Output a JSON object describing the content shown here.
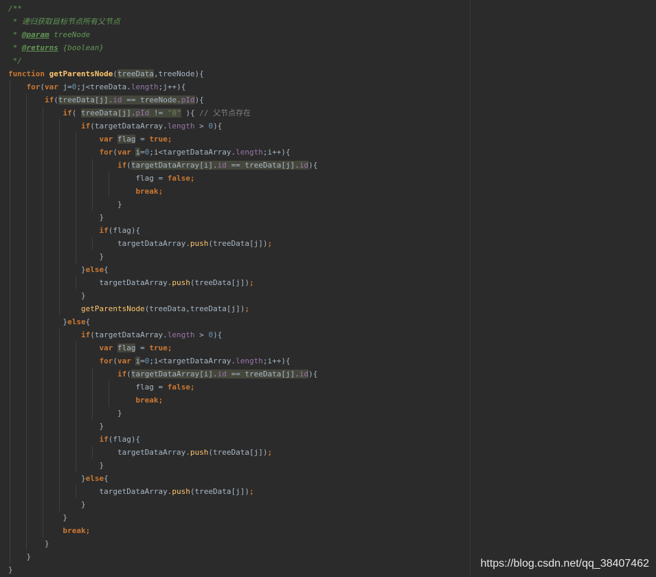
{
  "editor": {
    "lines": [
      {
        "indent": 0,
        "tokens": [
          {
            "t": "/**",
            "c": "cmt"
          }
        ]
      },
      {
        "indent": 0,
        "tokens": [
          {
            "t": " * 递归获取目标节点所有父节点",
            "c": "cmt"
          }
        ]
      },
      {
        "indent": 0,
        "tokens": [
          {
            "t": " * ",
            "c": "cmt"
          },
          {
            "t": "@param",
            "c": "tag"
          },
          {
            "t": " treeNode",
            "c": "type"
          }
        ]
      },
      {
        "indent": 0,
        "tokens": [
          {
            "t": " * ",
            "c": "cmt"
          },
          {
            "t": "@returns",
            "c": "tag"
          },
          {
            "t": " {boolean}",
            "c": "type"
          }
        ]
      },
      {
        "indent": 0,
        "tokens": [
          {
            "t": " */",
            "c": "cmt"
          }
        ]
      },
      {
        "indent": 0,
        "tokens": [
          {
            "t": "function ",
            "c": "kw"
          },
          {
            "t": "getParentsNode",
            "c": "fndef"
          },
          {
            "t": "(",
            "c": "p"
          },
          {
            "t": "treeData",
            "c": "p",
            "hl": true
          },
          {
            "t": ",treeNode){",
            "c": "p"
          }
        ]
      },
      {
        "indent": 1,
        "tokens": [
          {
            "t": "for",
            "c": "kw"
          },
          {
            "t": "(",
            "c": "p"
          },
          {
            "t": "var ",
            "c": "kw"
          },
          {
            "t": "j=",
            "c": "p"
          },
          {
            "t": "0",
            "c": "num"
          },
          {
            "t": ";j<treeData.",
            "c": "p"
          },
          {
            "t": "length",
            "c": "prop"
          },
          {
            "t": ";j++){",
            "c": "p"
          }
        ]
      },
      {
        "indent": 2,
        "tokens": [
          {
            "t": "if",
            "c": "kw"
          },
          {
            "t": "(",
            "c": "p"
          },
          {
            "t": "treeData[j].",
            "c": "p",
            "hl": true
          },
          {
            "t": "id",
            "c": "prop",
            "hl": true
          },
          {
            "t": " == treeNode.",
            "c": "p",
            "hl": true
          },
          {
            "t": "pId",
            "c": "prop",
            "hl": true
          },
          {
            "t": "){",
            "c": "p"
          }
        ]
      },
      {
        "indent": 3,
        "tokens": [
          {
            "t": "if",
            "c": "kw"
          },
          {
            "t": "( ",
            "c": "p"
          },
          {
            "t": "treeData[j].",
            "c": "p",
            "hl": true
          },
          {
            "t": "pId",
            "c": "prop",
            "hl": true
          },
          {
            "t": " != ",
            "c": "p",
            "hl": true
          },
          {
            "t": "\"0\"",
            "c": "str",
            "hl": true
          },
          {
            "t": " ){ ",
            "c": "p"
          },
          {
            "t": "// 父节点存在",
            "c": "cmt-line"
          }
        ]
      },
      {
        "indent": 4,
        "tokens": [
          {
            "t": "if",
            "c": "kw"
          },
          {
            "t": "(targetDataArray.",
            "c": "p"
          },
          {
            "t": "length",
            "c": "prop"
          },
          {
            "t": " > ",
            "c": "p"
          },
          {
            "t": "0",
            "c": "num"
          },
          {
            "t": "){",
            "c": "p"
          }
        ]
      },
      {
        "indent": 5,
        "tokens": [
          {
            "t": "var ",
            "c": "kw"
          },
          {
            "t": "flag",
            "c": "p",
            "hl": true
          },
          {
            "t": " = ",
            "c": "p"
          },
          {
            "t": "true",
            "c": "kw"
          },
          {
            "t": ";",
            "c": "kw"
          }
        ]
      },
      {
        "indent": 5,
        "tokens": [
          {
            "t": "for",
            "c": "kw"
          },
          {
            "t": "(",
            "c": "p"
          },
          {
            "t": "var ",
            "c": "kw"
          },
          {
            "t": "i",
            "c": "p",
            "hl": true
          },
          {
            "t": "=",
            "c": "p"
          },
          {
            "t": "0",
            "c": "num"
          },
          {
            "t": ";i<targetDataArray.",
            "c": "p"
          },
          {
            "t": "length",
            "c": "prop"
          },
          {
            "t": ";i++){",
            "c": "p"
          }
        ]
      },
      {
        "indent": 6,
        "tokens": [
          {
            "t": "if",
            "c": "kw"
          },
          {
            "t": "(",
            "c": "p"
          },
          {
            "t": "targetDataArray[i].",
            "c": "p",
            "hl": true
          },
          {
            "t": "id",
            "c": "prop",
            "hl": true
          },
          {
            "t": " == treeData[j].",
            "c": "p",
            "hl": true
          },
          {
            "t": "id",
            "c": "prop",
            "hl": true
          },
          {
            "t": "){",
            "c": "p"
          }
        ]
      },
      {
        "indent": 7,
        "tokens": [
          {
            "t": "flag = ",
            "c": "p"
          },
          {
            "t": "false",
            "c": "kw"
          },
          {
            "t": ";",
            "c": "kw"
          }
        ]
      },
      {
        "indent": 7,
        "tokens": [
          {
            "t": "break",
            "c": "kw"
          },
          {
            "t": ";",
            "c": "kw"
          }
        ]
      },
      {
        "indent": 6,
        "tokens": [
          {
            "t": "}",
            "c": "p"
          }
        ]
      },
      {
        "indent": 5,
        "tokens": [
          {
            "t": "}",
            "c": "p"
          }
        ]
      },
      {
        "indent": 5,
        "tokens": [
          {
            "t": "if",
            "c": "kw"
          },
          {
            "t": "(flag){",
            "c": "p"
          }
        ]
      },
      {
        "indent": 6,
        "tokens": [
          {
            "t": "targetDataArray.",
            "c": "p"
          },
          {
            "t": "push",
            "c": "fn"
          },
          {
            "t": "(treeData[j])",
            "c": "p"
          },
          {
            "t": ";",
            "c": "kw"
          }
        ]
      },
      {
        "indent": 5,
        "tokens": [
          {
            "t": "}",
            "c": "p"
          }
        ]
      },
      {
        "indent": 4,
        "tokens": [
          {
            "t": "}",
            "c": "p"
          },
          {
            "t": "else",
            "c": "kw"
          },
          {
            "t": "{",
            "c": "p"
          }
        ]
      },
      {
        "indent": 5,
        "tokens": [
          {
            "t": "targetDataArray.",
            "c": "p"
          },
          {
            "t": "push",
            "c": "fn"
          },
          {
            "t": "(treeData[j])",
            "c": "p"
          },
          {
            "t": ";",
            "c": "kw"
          }
        ]
      },
      {
        "indent": 4,
        "tokens": [
          {
            "t": "}",
            "c": "p"
          }
        ]
      },
      {
        "indent": 4,
        "tokens": [
          {
            "t": "getParentsNode",
            "c": "fn"
          },
          {
            "t": "(treeData,treeData[j])",
            "c": "p"
          },
          {
            "t": ";",
            "c": "kw"
          }
        ]
      },
      {
        "indent": 3,
        "tokens": [
          {
            "t": "}",
            "c": "p"
          },
          {
            "t": "else",
            "c": "kw"
          },
          {
            "t": "{",
            "c": "p"
          }
        ]
      },
      {
        "indent": 4,
        "tokens": [
          {
            "t": "if",
            "c": "kw"
          },
          {
            "t": "(targetDataArray.",
            "c": "p"
          },
          {
            "t": "length",
            "c": "prop"
          },
          {
            "t": " > ",
            "c": "p"
          },
          {
            "t": "0",
            "c": "num"
          },
          {
            "t": "){",
            "c": "p"
          }
        ]
      },
      {
        "indent": 5,
        "tokens": [
          {
            "t": "var ",
            "c": "kw"
          },
          {
            "t": "flag",
            "c": "p",
            "hl": true
          },
          {
            "t": " = ",
            "c": "p"
          },
          {
            "t": "true",
            "c": "kw"
          },
          {
            "t": ";",
            "c": "kw"
          }
        ]
      },
      {
        "indent": 5,
        "tokens": [
          {
            "t": "for",
            "c": "kw"
          },
          {
            "t": "(",
            "c": "p"
          },
          {
            "t": "var ",
            "c": "kw"
          },
          {
            "t": "i",
            "c": "p",
            "hl": true
          },
          {
            "t": "=",
            "c": "p"
          },
          {
            "t": "0",
            "c": "num"
          },
          {
            "t": ";i<targetDataArray.",
            "c": "p"
          },
          {
            "t": "length",
            "c": "prop"
          },
          {
            "t": ";i++){",
            "c": "p"
          }
        ]
      },
      {
        "indent": 6,
        "tokens": [
          {
            "t": "if",
            "c": "kw"
          },
          {
            "t": "(",
            "c": "p"
          },
          {
            "t": "targetDataArray[i].",
            "c": "p",
            "hl": true
          },
          {
            "t": "id",
            "c": "prop",
            "hl": true
          },
          {
            "t": " == treeData[j].",
            "c": "p",
            "hl": true
          },
          {
            "t": "id",
            "c": "prop",
            "hl": true
          },
          {
            "t": "){",
            "c": "p"
          }
        ]
      },
      {
        "indent": 7,
        "tokens": [
          {
            "t": "flag = ",
            "c": "p"
          },
          {
            "t": "false",
            "c": "kw"
          },
          {
            "t": ";",
            "c": "kw"
          }
        ]
      },
      {
        "indent": 7,
        "tokens": [
          {
            "t": "break",
            "c": "kw"
          },
          {
            "t": ";",
            "c": "kw"
          }
        ]
      },
      {
        "indent": 6,
        "tokens": [
          {
            "t": "}",
            "c": "p"
          }
        ]
      },
      {
        "indent": 5,
        "tokens": [
          {
            "t": "}",
            "c": "p"
          }
        ]
      },
      {
        "indent": 5,
        "tokens": [
          {
            "t": "if",
            "c": "kw"
          },
          {
            "t": "(flag){",
            "c": "p"
          }
        ]
      },
      {
        "indent": 6,
        "tokens": [
          {
            "t": "targetDataArray.",
            "c": "p"
          },
          {
            "t": "push",
            "c": "fn"
          },
          {
            "t": "(treeData[j])",
            "c": "p"
          },
          {
            "t": ";",
            "c": "kw"
          }
        ]
      },
      {
        "indent": 5,
        "tokens": [
          {
            "t": "}",
            "c": "p"
          }
        ]
      },
      {
        "indent": 4,
        "tokens": [
          {
            "t": "}",
            "c": "p"
          },
          {
            "t": "else",
            "c": "kw"
          },
          {
            "t": "{",
            "c": "p"
          }
        ]
      },
      {
        "indent": 5,
        "tokens": [
          {
            "t": "targetDataArray.",
            "c": "p"
          },
          {
            "t": "push",
            "c": "fn"
          },
          {
            "t": "(treeData[j])",
            "c": "p"
          },
          {
            "t": ";",
            "c": "kw"
          }
        ]
      },
      {
        "indent": 4,
        "tokens": [
          {
            "t": "}",
            "c": "p"
          }
        ]
      },
      {
        "indent": 3,
        "tokens": [
          {
            "t": "}",
            "c": "p"
          }
        ]
      },
      {
        "indent": 3,
        "tokens": [
          {
            "t": "break",
            "c": "kw"
          },
          {
            "t": ";",
            "c": "kw"
          }
        ]
      },
      {
        "indent": 2,
        "tokens": [
          {
            "t": "}",
            "c": "p"
          }
        ]
      },
      {
        "indent": 1,
        "tokens": [
          {
            "t": "}",
            "c": "p"
          }
        ]
      },
      {
        "indent": 0,
        "tokens": [
          {
            "t": "}",
            "c": "p"
          }
        ]
      }
    ]
  },
  "watermark": "https://blog.csdn.net/qq_38407462"
}
